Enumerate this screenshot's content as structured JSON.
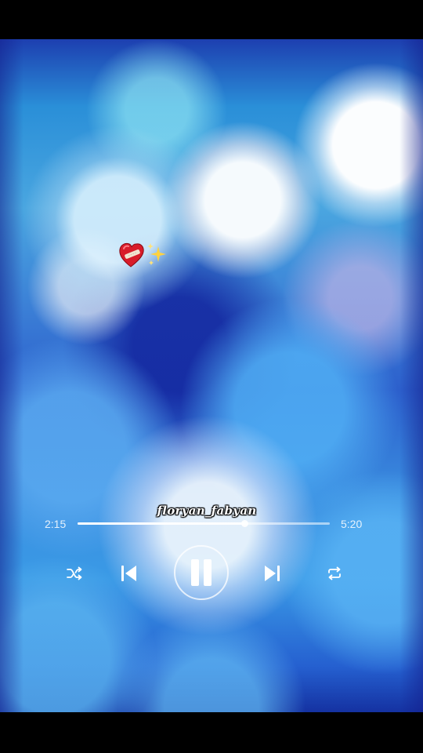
{
  "player": {
    "username": "floryan_fabyan",
    "elapsed": "2:15",
    "total": "5:20",
    "progress": 0.66
  },
  "stickers": {
    "icons": [
      "mending-heart-icon",
      "sparkles-icon"
    ]
  },
  "controls": {
    "icons": [
      "shuffle-icon",
      "previous-icon",
      "pause-icon",
      "next-icon",
      "repeat-icon"
    ]
  },
  "colors": {
    "accent": "#ffffff",
    "background_blue": "#2a8fd8"
  }
}
